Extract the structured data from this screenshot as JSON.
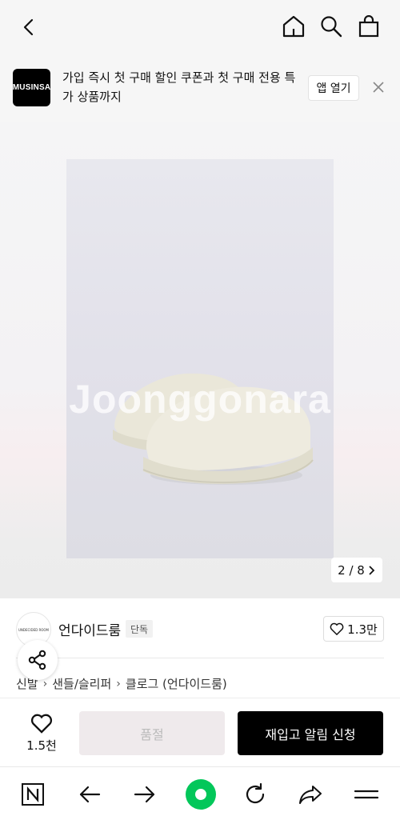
{
  "banner": {
    "logo": "MUSINSA",
    "text": "가입 즉시 첫 구매 할인 쿠폰과 첫 구매 전용 특가 상품까지",
    "open_app": "앱 열기"
  },
  "gallery": {
    "watermark": "Joonggonara",
    "counter": "2 / 8"
  },
  "brand": {
    "avatar_text": "UNDECIDED ROOM",
    "name": "언다이드룸",
    "badge": "단독",
    "likes": "1.3만"
  },
  "breadcrumb": [
    "신발",
    "샌들/슬리퍼",
    "클로그 (언다이드룸)"
  ],
  "actions": {
    "wish_count": "1.5천",
    "soldout": "품절",
    "restock": "재입고 알림 신청"
  },
  "icons": [
    "back-arrow-icon",
    "home-icon",
    "search-icon",
    "shopping-bag-icon",
    "close-icon",
    "heart-icon",
    "share-icon",
    "chevron-right-icon",
    "naver-icon",
    "prev-icon",
    "next-icon",
    "green-dot-icon",
    "reload-icon",
    "forward-share-icon",
    "menu-icon"
  ]
}
